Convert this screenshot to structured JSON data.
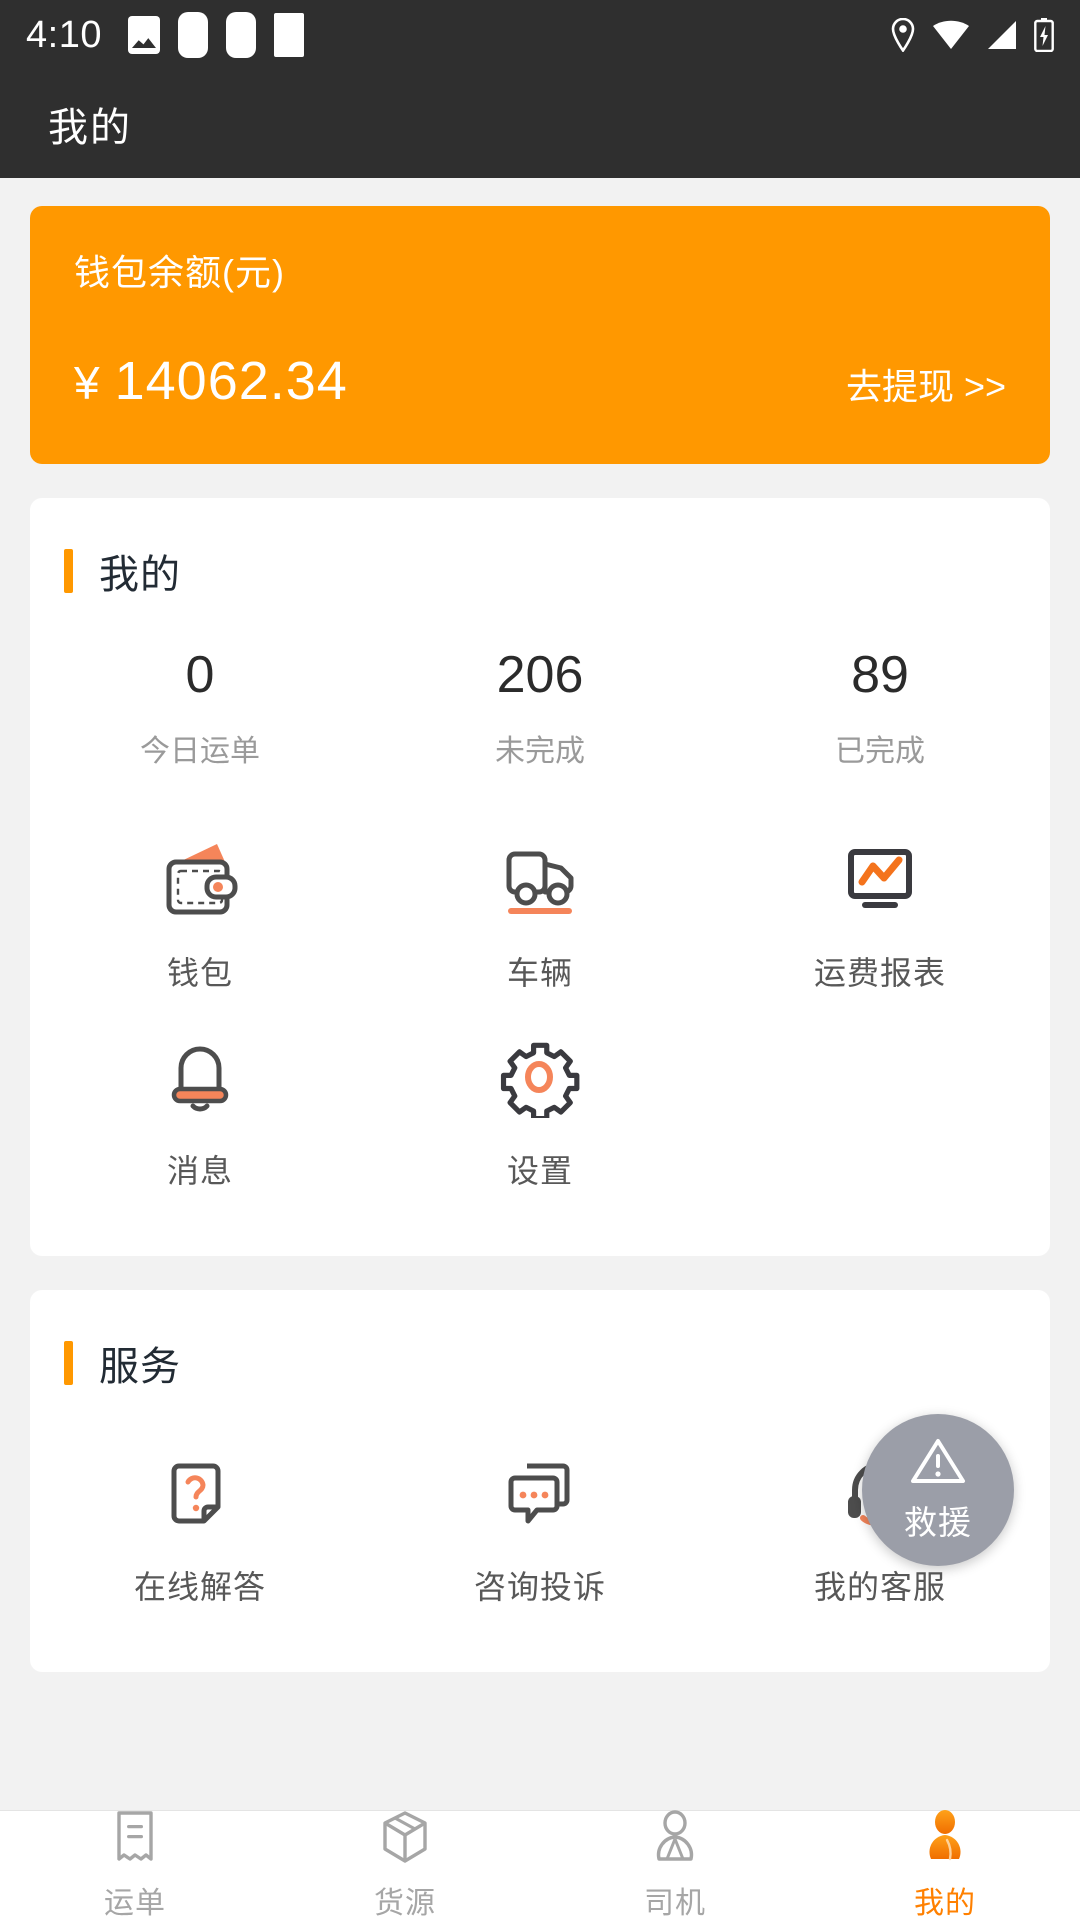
{
  "status_bar": {
    "time": "4:10",
    "left_icons": [
      "image-icon",
      "app-notification-1",
      "app-notification-2",
      "app-notification-3"
    ],
    "right_icons": [
      "location-icon",
      "wifi-icon",
      "signal-icon",
      "battery-charging-icon"
    ]
  },
  "app_bar": {
    "title": "我的"
  },
  "wallet": {
    "label": "钱包余额(元)",
    "currency": "¥",
    "amount": "14062.34",
    "withdraw_link": "去提现 >>",
    "background_color": "#FF9800"
  },
  "mine_section": {
    "title": "我的",
    "accent_color": "#FF9800",
    "stats": [
      {
        "value": "0",
        "label": "今日运单"
      },
      {
        "value": "206",
        "label": "未完成"
      },
      {
        "value": "89",
        "label": "已完成"
      }
    ],
    "entries": [
      {
        "icon": "wallet-icon",
        "label": "钱包"
      },
      {
        "icon": "truck-icon",
        "label": "车辆"
      },
      {
        "icon": "freight-report-icon",
        "label": "运费报表"
      },
      {
        "icon": "bell-icon",
        "label": "消息"
      },
      {
        "icon": "gear-icon",
        "label": "设置"
      }
    ]
  },
  "service_section": {
    "title": "服务",
    "entries": [
      {
        "icon": "question-document-icon",
        "label": "在线解答"
      },
      {
        "icon": "chat-bubbles-icon",
        "label": "咨询投诉"
      },
      {
        "icon": "headset-icon",
        "label": "我的客服"
      }
    ]
  },
  "rescue_fab": {
    "icon": "warning-triangle-icon",
    "label": "救援",
    "background_color": "#9B9EA8"
  },
  "bottom_nav": {
    "active_color": "#FF8000",
    "inactive_color": "#A6A6A6",
    "items": [
      {
        "icon": "waybill-icon",
        "label": "运单",
        "active": false
      },
      {
        "icon": "cargo-box-icon",
        "label": "货源",
        "active": false
      },
      {
        "icon": "driver-icon",
        "label": "司机",
        "active": false
      },
      {
        "icon": "profile-icon",
        "label": "我的",
        "active": true
      }
    ]
  }
}
